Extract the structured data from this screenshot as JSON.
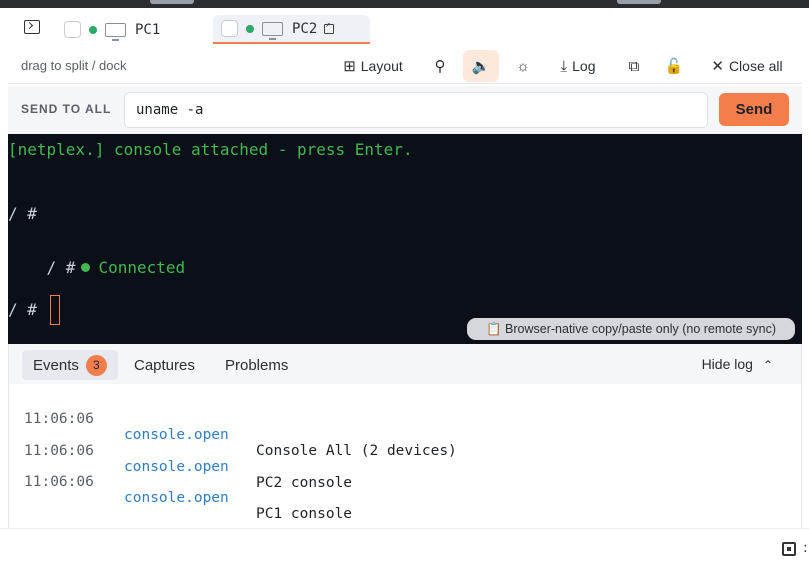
{
  "tabs": [
    {
      "label": "PC1",
      "active": false
    },
    {
      "label": "PC2",
      "active": true
    }
  ],
  "toolbar": {
    "hint": "drag to split / dock",
    "layout_label": "Layout",
    "log_label": "Log",
    "close_all_label": "Close all"
  },
  "send": {
    "label": "SEND TO ALL",
    "value": "uname -a",
    "button": "Send"
  },
  "terminal": {
    "banner": "[netplex.] console attached - press Enter.",
    "prompt": "/ #",
    "connected": "Connected",
    "copy_note": "📋 Browser-native copy/paste only (no remote sync)"
  },
  "log": {
    "tabs": [
      {
        "label": "Events",
        "badge": "3"
      },
      {
        "label": "Captures"
      },
      {
        "label": "Problems"
      }
    ],
    "hide_label": "Hide log",
    "rows": [
      {
        "time": "11:06:06",
        "event": "console.open",
        "message": "Console All (2 devices)"
      },
      {
        "time": "11:06:06",
        "event": "console.open",
        "message": "PC2 console"
      },
      {
        "time": "11:06:06",
        "event": "console.open",
        "message": "PC1 console"
      }
    ]
  },
  "footer": {
    "more": ":"
  },
  "colors": {
    "accent": "#f47e4b",
    "terminal_bg": "#0b0f17",
    "terminal_green": "#3fb950",
    "event_link": "#2f7ec4"
  }
}
